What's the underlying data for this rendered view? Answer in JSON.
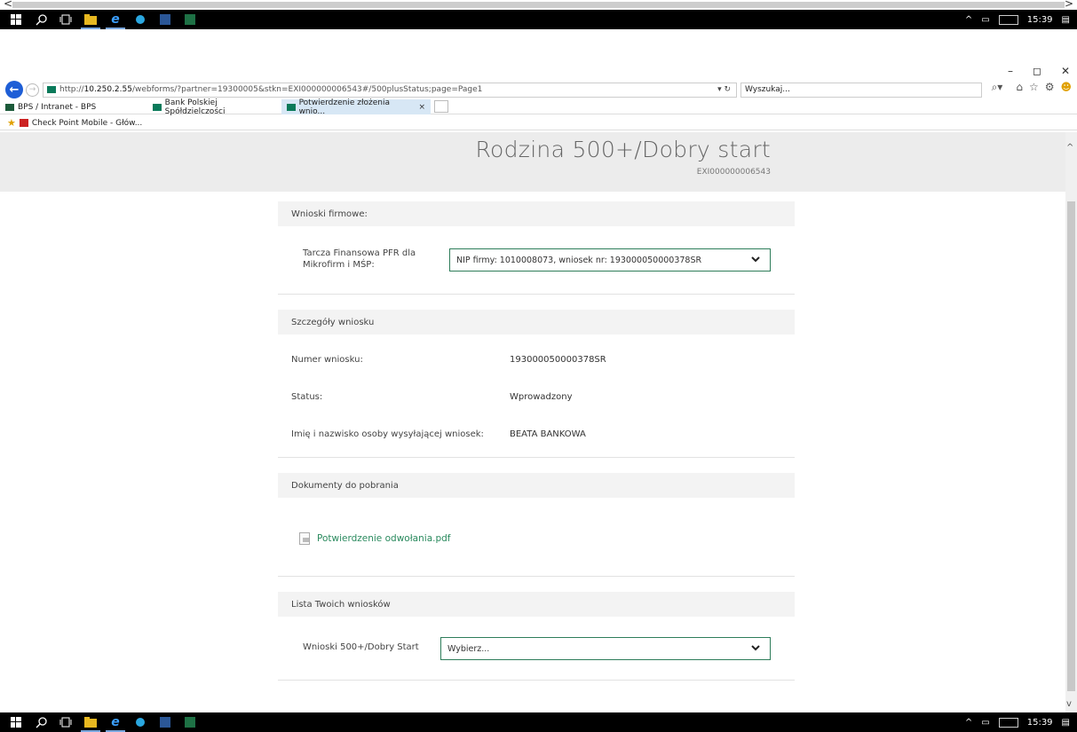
{
  "taskbar": {
    "clock": "15:39"
  },
  "browser": {
    "url_prefix": "http://",
    "url_host": "10.250.2.55",
    "url_path": "/webforms/?partner=19300005&stkn=EXI000000006543#/500plusStatus;page=Page1",
    "url_controls": "▾ ↻",
    "search_placeholder": "Wyszukaj...",
    "tabs": [
      {
        "label": "BPS / Intranet - BPS"
      },
      {
        "label": "Bank Polskiej Spółdzielczości"
      },
      {
        "label": "Potwierdzenie złożenia wnio...",
        "close": "×"
      }
    ],
    "favorites": [
      {
        "label": "Check Point Mobile - Głów..."
      }
    ]
  },
  "header": {
    "title": "Rodzina 500+/Dobry start",
    "subtitle": "EXI000000006543"
  },
  "company": {
    "section_title": "Wnioski firmowe:",
    "field_label": "Tarcza Finansowa PFR dla Mikrofirm i MŚP:",
    "selected": "NIP firmy: 1010008073, wniosek nr: 193000050000378SR"
  },
  "details": {
    "section_title": "Szczegóły wniosku",
    "rows": [
      {
        "label": "Numer wniosku:",
        "value": "193000050000378SR"
      },
      {
        "label": "Status:",
        "value": "Wprowadzony"
      },
      {
        "label": "Imię i nazwisko osoby wysyłającej wniosek:",
        "value": "BEATA BANKOWA"
      }
    ]
  },
  "documents": {
    "section_title": "Dokumenty do pobrania",
    "link": "Potwierdzenie odwołania.pdf"
  },
  "applications": {
    "section_title": "Lista Twoich wniosków",
    "field_label": "Wnioski 500+/Dobry Start",
    "selected": "Wybierz..."
  }
}
